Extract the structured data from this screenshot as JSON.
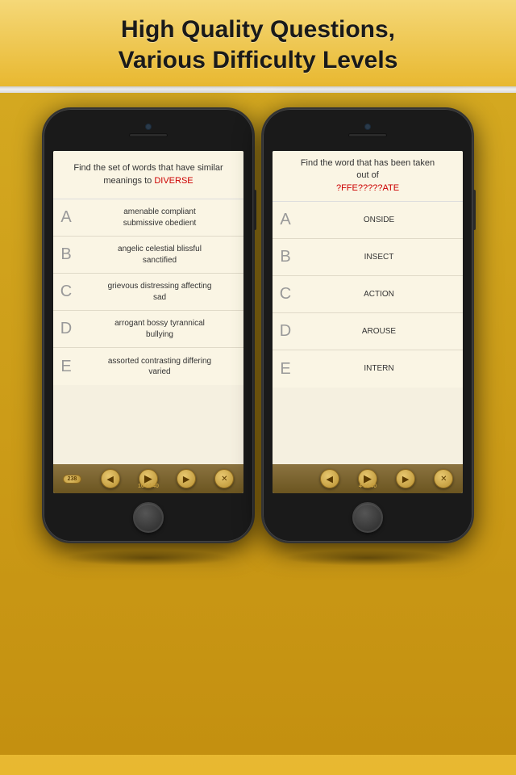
{
  "header": {
    "line1": "High Quality Questions,",
    "line2": "Various Difficulty Levels"
  },
  "phone1": {
    "question": {
      "prefix": "Find the set of words that have similar meanings to ",
      "keyword": "DIVERSE"
    },
    "answers": [
      {
        "letter": "A",
        "text": "amenable compliant\nsubmissive obedient"
      },
      {
        "letter": "B",
        "text": "angelic celestial blissful\nsanctified"
      },
      {
        "letter": "C",
        "text": "grievous distressing affecting\nsad"
      },
      {
        "letter": "D",
        "text": "arrogant bossy tyrannical\nbullying"
      },
      {
        "letter": "E",
        "text": "assorted contrasting differing\nvaried"
      }
    ],
    "toolbar": {
      "badge": "238",
      "count": "10 of 40"
    }
  },
  "phone2": {
    "question": {
      "prefix": "Find the word that has been taken out of\n",
      "keyword": "?FFE?????ATE"
    },
    "answers": [
      {
        "letter": "A",
        "text": "ONSIDE"
      },
      {
        "letter": "B",
        "text": "INSECT"
      },
      {
        "letter": "C",
        "text": "ACTION"
      },
      {
        "letter": "D",
        "text": "AROUSE"
      },
      {
        "letter": "E",
        "text": "INTERN"
      }
    ],
    "toolbar": {
      "badge": "",
      "count": "4 of 40"
    }
  },
  "icons": {
    "back": "◀",
    "play": "▶",
    "forward": "▶",
    "next": "▶",
    "close": "✕",
    "arrow_left": "◀",
    "arrow_right": "▶"
  }
}
